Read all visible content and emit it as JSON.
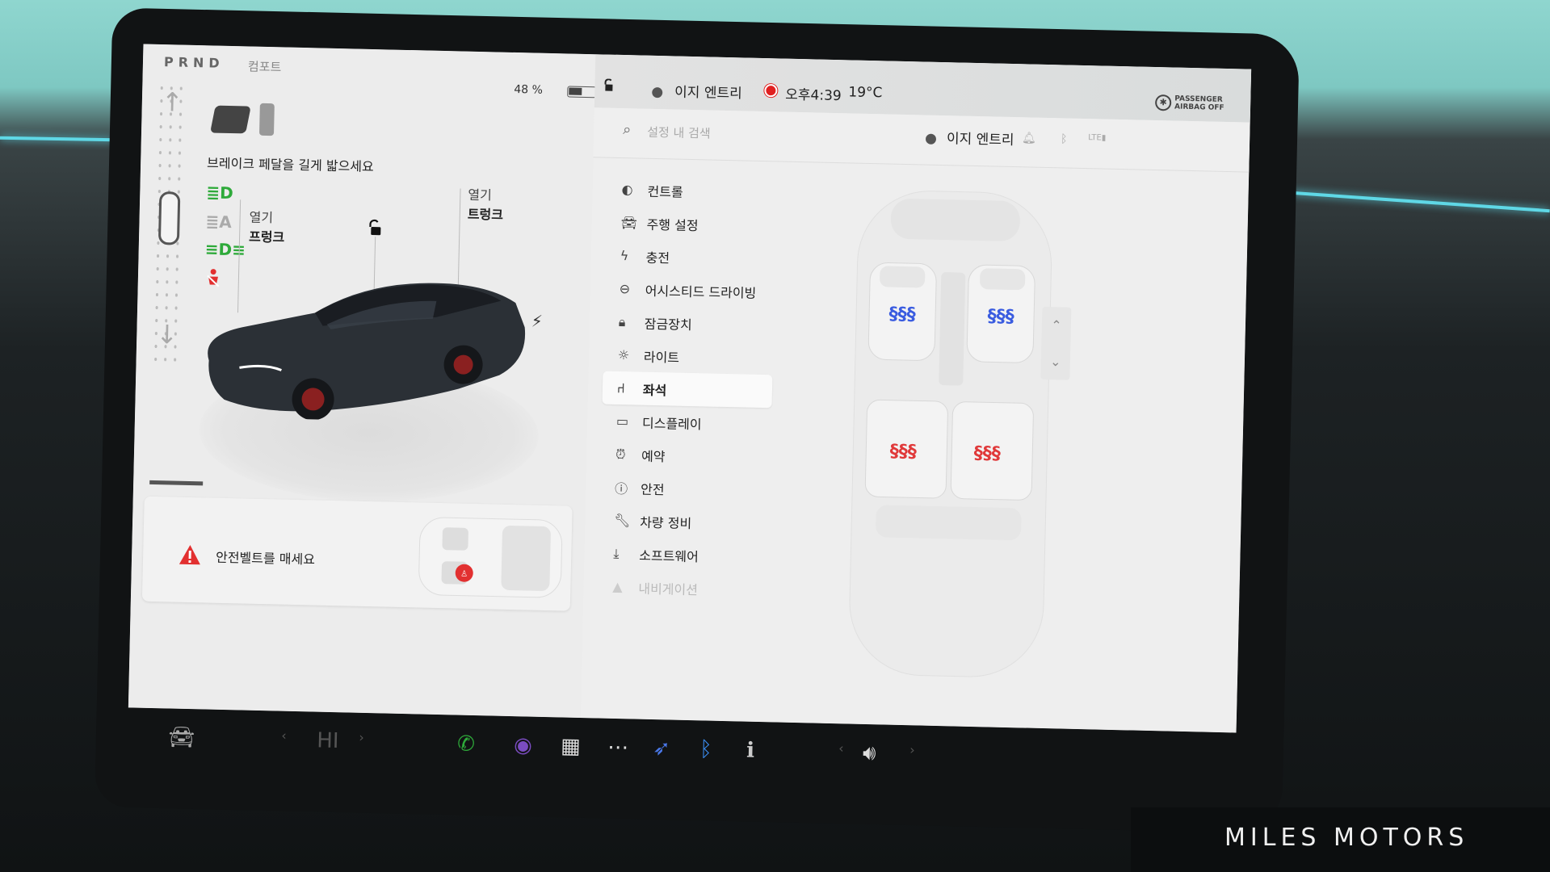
{
  "status": {
    "gear": "PRND",
    "drive_mode": "컴포트",
    "battery_pct": "48 %",
    "driver_profile": "이지 엔트리",
    "time": "오후4:39",
    "temperature": "19°C",
    "airbag_line1": "PASSENGER",
    "airbag_line2": "AIRBAG OFF"
  },
  "left_panel": {
    "brake_message": "브레이크 페달을 길게 밟으세요",
    "frunk_action": "열기",
    "frunk_label": "프렁크",
    "trunk_action": "열기",
    "trunk_label": "트렁크",
    "seatbelt_warning": "안전벨트를 매세요"
  },
  "search": {
    "placeholder": "설정 내 검색",
    "profile": "이지 엔트리"
  },
  "menu": {
    "items": [
      {
        "label": "컨트롤",
        "icon": "toggle-icon"
      },
      {
        "label": "주행 설정",
        "icon": "car-icon"
      },
      {
        "label": "충전",
        "icon": "bolt-icon"
      },
      {
        "label": "어시스티드 드라이빙",
        "icon": "steering-wheel-icon"
      },
      {
        "label": "잠금장치",
        "icon": "lock-icon"
      },
      {
        "label": "라이트",
        "icon": "sun-icon"
      },
      {
        "label": "좌석",
        "icon": "seat-icon"
      },
      {
        "label": "디스플레이",
        "icon": "display-icon"
      },
      {
        "label": "예약",
        "icon": "alarm-icon"
      },
      {
        "label": "안전",
        "icon": "info-circle-icon"
      },
      {
        "label": "차량 정비",
        "icon": "wrench-icon"
      },
      {
        "label": "소프트웨어",
        "icon": "download-icon"
      },
      {
        "label": "내비게이션",
        "icon": "navigation-icon"
      }
    ],
    "active_index": 6
  },
  "seat_heaters": {
    "front_left": "blue",
    "front_right": "blue",
    "rear_left": "red",
    "rear_right": "red"
  },
  "taskbar": {
    "icons": [
      "car-icon",
      "phone-icon",
      "camera-icon",
      "calendar-icon",
      "more-icon",
      "nav-app-icon",
      "bluetooth-icon",
      "info-icon",
      "volume-icon"
    ]
  },
  "watermark": "MILES MOTORS",
  "colors": {
    "heat_blue": "#3a5ce0",
    "heat_red": "#e0393a",
    "indicator_green": "#2eaa3a",
    "warning_red": "#e23030"
  }
}
